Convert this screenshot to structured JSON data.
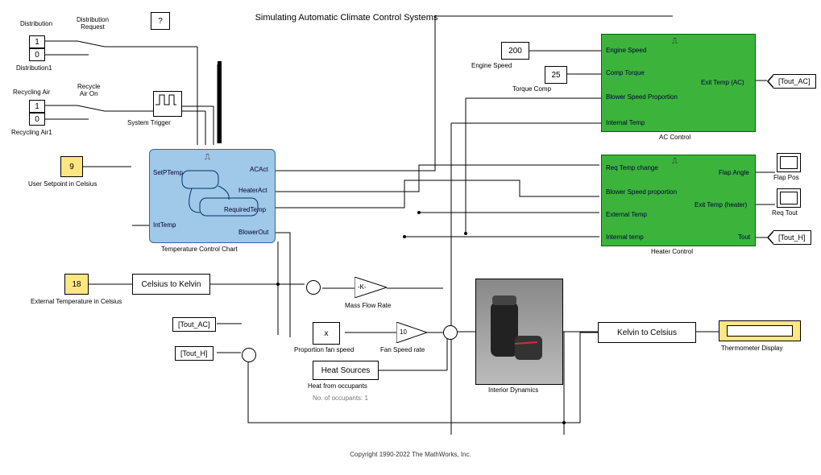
{
  "title": "Simulating Automatic Climate Control Systems",
  "copyright": "Copyright 1990-2022 The MathWorks, Inc.",
  "help": "?",
  "labels": {
    "distribution": "Distribution",
    "dist_req": "Distribution\nRequest",
    "distribution1": "Distribution1",
    "recycling_air": "Recycling Air",
    "recycle_on": "Recycle\nAir On",
    "recycling_air1": "Recycling Air1",
    "sys_trigger": "System Trigger",
    "user_setpoint": "User Setpoint in Celsius",
    "ext_temp": "External Temperature in Celsius",
    "temp_chart": "Temperature Control Chart",
    "c2k": "Celsius to Kelvin",
    "mass_flow": "Mass Flow Rate",
    "prop_fan": "Proportion fan speed",
    "fan_rate": "Fan Speed rate",
    "heat_src": "Heat Sources",
    "heat_occ": "Heat from occupants",
    "occupants": "No. of occupants: 1",
    "interior": "Interior Dynamics",
    "k2c": "Kelvin to Celsius",
    "thermo": "Thermometer Display",
    "engine": "Engine Speed",
    "torque": "Torque Comp",
    "ac_ctrl": "AC Control",
    "heater_ctrl": "Heater Control",
    "flap_pos": "Flap Pos",
    "req_tout": "Req Tout"
  },
  "values": {
    "d1a": "1",
    "d1b": "0",
    "r1a": "1",
    "r1b": "0",
    "setpoint": "9",
    "ext_temp_c": "18",
    "engine": "200",
    "torque": "25",
    "gain_k": "-K-",
    "gain_10": "10",
    "prod": "x",
    "tout_ac": "[Tout_AC]",
    "tout_h": "[Tout_H]",
    "tout_ac2": "[Tout_AC]",
    "tout_h2": "[Tout_H]"
  },
  "ports": {
    "setp": "SetPTemp",
    "inttemp": "IntTemp",
    "acact": "ACAct",
    "heater": "HeaterAct",
    "reqtemp": "RequiredTemp",
    "blower": "BlowerOut",
    "eng_spd": "Engine Speed",
    "comp_t": "Comp Torque",
    "blow_p": "Blower Speed Proportion",
    "int_t": "Internal Temp",
    "exit_ac": "Exit Temp (AC)",
    "req_tc": "Req Temp change",
    "blow_p2": "Blower Speed proportion",
    "ext_t": "External Temp",
    "int_t2": "Internal temp",
    "flap": "Flap Angle",
    "exit_h": "Exit Temp (heater)",
    "tout": "Tout"
  }
}
